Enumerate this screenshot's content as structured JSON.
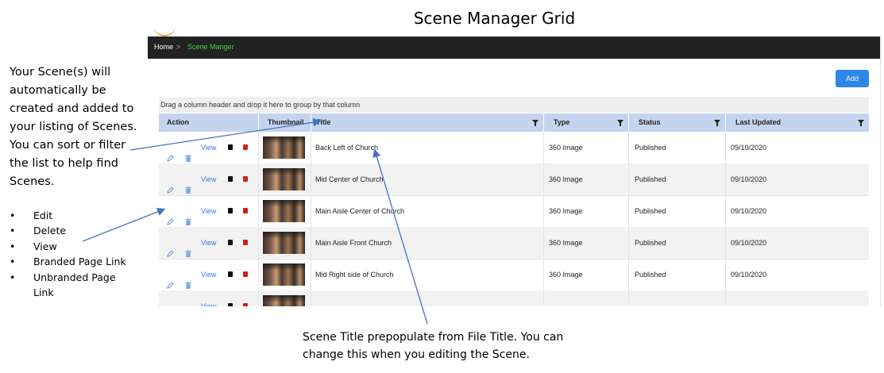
{
  "page_title": "Scene Manager Grid",
  "breadcrumb": {
    "home": "Home",
    "separator": ">",
    "current": "Scene Manger"
  },
  "toolbar": {
    "add_label": "Add"
  },
  "grid": {
    "group_panel_text": "Drag a column header and drop it here to group by that column",
    "columns": [
      "Action",
      "Thumbnail",
      "Title",
      "Type",
      "Status",
      "Last Updated"
    ],
    "action_view_label": "View",
    "rows": [
      {
        "title": "Back Left of Church",
        "type": "360 Image",
        "status": "Published",
        "last_updated": "09/10/2020"
      },
      {
        "title": "Mid Center of Church",
        "type": "360 Image",
        "status": "Published",
        "last_updated": "09/10/2020"
      },
      {
        "title": "Main Aisle Center of Church",
        "type": "360 Image",
        "status": "Published",
        "last_updated": "09/10/2020"
      },
      {
        "title": "Main Aisle Front Church",
        "type": "360 Image",
        "status": "Published",
        "last_updated": "09/10/2020"
      },
      {
        "title": "Mid Right side of Church",
        "type": "360 Image",
        "status": "Published",
        "last_updated": "09/10/2020"
      }
    ]
  },
  "annotations": {
    "left_note": "Your Scene(s) will automatically be created and added to your listing of Scenes. You can sort or filter the list to help find Scenes.",
    "bullets": [
      "Edit",
      "Delete",
      "View",
      "Branded Page Link",
      "Unbranded Page Link"
    ],
    "bottom_note": "Scene Title prepopulate from File Title.  You can change this when you editing the Scene."
  },
  "colors": {
    "header_bar": "#222222",
    "breadcrumb_current": "#3bd93b",
    "add_button": "#2c87e8",
    "grid_header": "#c5d4ee",
    "arrow": "#4472c4",
    "row_alt": "#f2f2f2"
  }
}
